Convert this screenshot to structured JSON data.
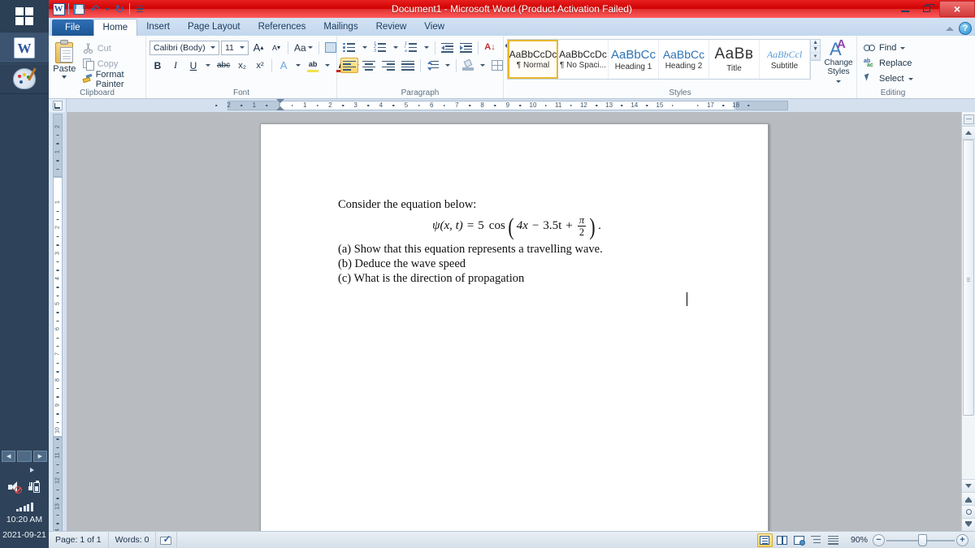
{
  "taskbar": {
    "start_label": "Start",
    "apps": [
      {
        "name": "Microsoft Word",
        "glyph": "W"
      },
      {
        "name": "Paint",
        "glyph": ""
      }
    ],
    "tray": {
      "volume": "Volume muted",
      "battery": "Battery charging",
      "network": "Network signal"
    },
    "clock_time": "10:20 AM",
    "clock_date": "2021-09-21"
  },
  "titlebar": {
    "title": "Document1  -  Microsoft Word (Product Activation Failed)",
    "minimize": "–",
    "restore": "❐",
    "close": "×"
  },
  "quick_access": {
    "word_glyph": "W",
    "items": [
      "save-icon",
      "undo-icon",
      "redo-icon",
      "customize-icon"
    ]
  },
  "tabs": [
    {
      "label": "File",
      "active": false,
      "kind": "file"
    },
    {
      "label": "Home",
      "active": true,
      "kind": "normal"
    },
    {
      "label": "Insert",
      "active": false,
      "kind": "normal"
    },
    {
      "label": "Page Layout",
      "active": false,
      "kind": "normal"
    },
    {
      "label": "References",
      "active": false,
      "kind": "normal"
    },
    {
      "label": "Mailings",
      "active": false,
      "kind": "normal"
    },
    {
      "label": "Review",
      "active": false,
      "kind": "normal"
    },
    {
      "label": "View",
      "active": false,
      "kind": "normal"
    }
  ],
  "tab_right": {
    "collapse_ribbon": "Minimize the Ribbon",
    "help": "?"
  },
  "ribbon": {
    "clipboard": {
      "label": "Clipboard",
      "paste": "Paste",
      "cut": "Cut",
      "copy": "Copy",
      "format_painter": "Format Painter",
      "launcher": "↘"
    },
    "font": {
      "label": "Font",
      "font_name": "Calibri (Body)",
      "font_size": "11",
      "grow": "A",
      "shrink": "A",
      "change_case": "Aa",
      "clear_formatting": "clear-formatting-icon",
      "bold": "B",
      "italic": "I",
      "underline": "U",
      "strikethrough": "abc",
      "subscript": "x₂",
      "superscript": "x²",
      "text_effects": "A",
      "highlight": "ab",
      "font_color": "A",
      "launcher": "↘"
    },
    "paragraph": {
      "label": "Paragraph",
      "bullets": "bullets-icon",
      "numbering": "numbering-icon",
      "multilevel": "multilevel-list-icon",
      "decrease_indent": "decrease-indent-icon",
      "increase_indent": "increase-indent-icon",
      "sort": "A↓",
      "show_marks": "¶",
      "align_left": "align-left-icon",
      "align_center": "align-center-icon",
      "align_right": "align-right-icon",
      "justify": "justify-icon",
      "line_spacing": "line-spacing-icon",
      "shading": "shading-icon",
      "borders": "borders-icon",
      "launcher": "↘"
    },
    "styles": {
      "label": "Styles",
      "items": [
        {
          "preview": "AaBbCcDc",
          "name": "¶ Normal",
          "selected": true,
          "kind": "normal"
        },
        {
          "preview": "AaBbCcDc",
          "name": "¶ No Spaci...",
          "selected": false,
          "kind": "normal"
        },
        {
          "preview": "AaBbCс",
          "name": "Heading 1",
          "selected": false,
          "kind": "h1"
        },
        {
          "preview": "AaBbCc",
          "name": "Heading 2",
          "selected": false,
          "kind": "h2"
        },
        {
          "preview": "AaBв",
          "name": "Title",
          "selected": false,
          "kind": "ti"
        },
        {
          "preview": "AaBbCcl",
          "name": "Subtitle",
          "selected": false,
          "kind": "su"
        }
      ],
      "change_styles_line1": "Change",
      "change_styles_line2": "Styles",
      "scroll_up": "▲",
      "scroll_down": "▼",
      "scroll_more": "▾",
      "launcher": "↘"
    },
    "editing": {
      "label": "Editing",
      "find": "Find",
      "replace": "Replace",
      "select": "Select"
    }
  },
  "ruler": {
    "tab_selector": "tab-stop-selector",
    "h_labels": [
      "2",
      "1",
      "1",
      "2",
      "3",
      "4",
      "5",
      "6",
      "7",
      "8",
      "9",
      "10",
      "11",
      "12",
      "13",
      "14",
      "15",
      "17",
      "18"
    ],
    "v_labels": [
      "2",
      "1",
      "1",
      "2",
      "3",
      "4",
      "5",
      "6",
      "7",
      "8",
      "9",
      "10",
      "11",
      "12",
      "13",
      "14"
    ]
  },
  "document": {
    "intro": "Consider the equation below:",
    "equation": {
      "lhs": "ψ(x, t)",
      "equals": "=",
      "amplitude": "5",
      "function": "cos",
      "open_paren": "(",
      "term_k": "4x",
      "minus": "−",
      "term_w": "3.5t",
      "plus": "+",
      "frac_num": "π",
      "frac_den": "2",
      "close_paren": ")",
      "period": "."
    },
    "items": [
      "(a) Show that this equation represents a travelling wave.",
      "(b) Deduce the wave speed",
      "(c) What is the direction of propagation"
    ]
  },
  "statusbar": {
    "page": "Page: 1 of 1",
    "words": "Words: 0",
    "proofing": "proofing-errors-icon",
    "views": [
      {
        "name": "print-layout",
        "active": true
      },
      {
        "name": "full-screen-reading",
        "active": false
      },
      {
        "name": "web-layout",
        "active": false
      },
      {
        "name": "outline",
        "active": false
      },
      {
        "name": "draft",
        "active": false
      }
    ],
    "zoom_value": "90%",
    "zoom_out": "−",
    "zoom_in": "+"
  },
  "colors": {
    "title_red": "#d40000",
    "ribbon_blue": "#2e6fb5",
    "accent_gold": "#ffd266",
    "taskbar": "#2e4259"
  }
}
